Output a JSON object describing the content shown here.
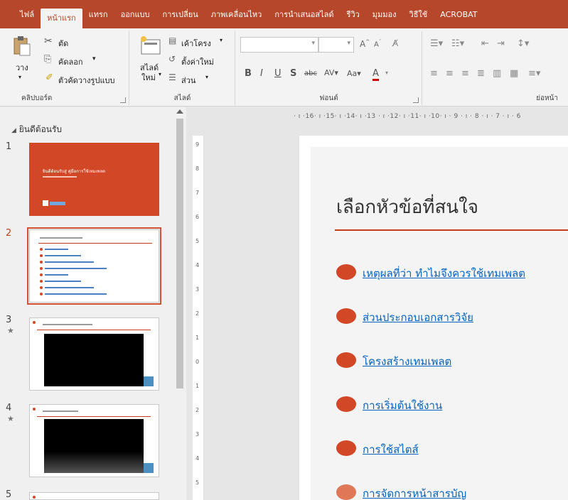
{
  "tabs": [
    "ไฟล์",
    "หน้าแรก",
    "แทรก",
    "ออกแบบ",
    "การเปลี่ยน",
    "ภาพเคลื่อนไหว",
    "การนำเสนอสไลด์",
    "รีวิว",
    "มุมมอง",
    "วิธีใช้",
    "ACROBAT"
  ],
  "ribbon": {
    "clipboard": {
      "paste": "วาง",
      "cut": "ตัด",
      "copy": "คัดลอก",
      "format_painter": "ตัวคัดวางรูปแบบ",
      "label": "คลิปบอร์ด"
    },
    "slides": {
      "new_slide": "สไลด์",
      "new_slide_2": "ใหม่",
      "layout": "เค้าโครง",
      "reset": "ตั้งค่าใหม่",
      "section": "ส่วน",
      "label": "สไลด์"
    },
    "font": {
      "label": "ฟอนต์"
    },
    "paragraph": {
      "label": "ย่อหน้า"
    }
  },
  "thumbnails": {
    "section": "ยินดีต้อนรับ",
    "slides": [
      {
        "num": "1",
        "title": "ยินดีต้อนรับสู่ คู่มือการใช้เทมเพลต"
      },
      {
        "num": "2"
      },
      {
        "num": "3",
        "star": "★"
      },
      {
        "num": "4",
        "star": "★"
      },
      {
        "num": "5"
      }
    ]
  },
  "hruler": "· ı ·16· ı ·15· ı ·14· ı ·13 · ı ·12· ı ·11· ı ·10· ı · 9 · ı · 8 · ı · 7 · ı · 6",
  "vruler": [
    "9",
    "8",
    "7",
    "6",
    "5",
    "4",
    "3",
    "2",
    "1",
    "0",
    "1",
    "2",
    "3",
    "4",
    "5"
  ],
  "slide": {
    "title": "เลือกหัวข้อที่สนใจ",
    "links": [
      "เหตุผลที่ว่า ทำไมจึงควรใช้เทมเพลต",
      "ส่วนประกอบเอกสารวิจัย",
      "โครงสร้างเทมเพลต",
      "การเริ่มต้นใช้งาน",
      "การใช้สไตส์",
      "การจัดการหน้าสารบัญ"
    ]
  }
}
